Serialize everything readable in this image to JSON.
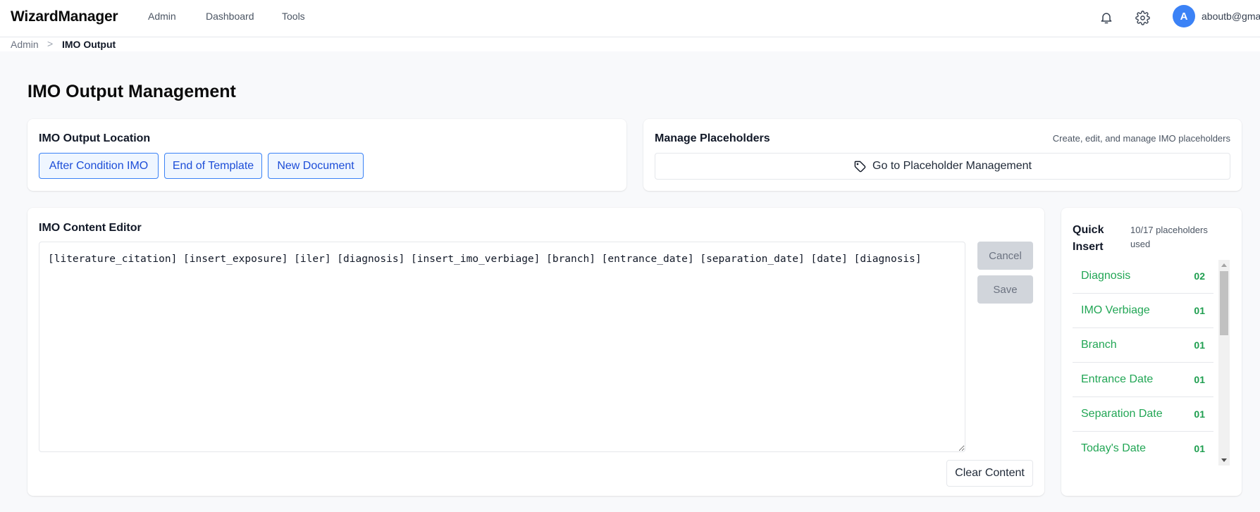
{
  "app": {
    "title": "WizardManager",
    "nav": [
      {
        "label": "Admin"
      },
      {
        "label": "Dashboard"
      },
      {
        "label": "Tools"
      }
    ],
    "user": {
      "avatar_initial": "A",
      "email": "aboutb@gma",
      "avatar_color": "#3b82f6"
    },
    "icons": {
      "notifications": "bell-icon",
      "settings": "gear-icon"
    }
  },
  "breadcrumb": {
    "root": "Admin",
    "separator": ">",
    "current": "IMO Output"
  },
  "page": {
    "title": "IMO Output Management"
  },
  "output_location": {
    "title": "IMO Output Location",
    "options": [
      {
        "label": "After Condition IMO"
      },
      {
        "label": "End of Template"
      },
      {
        "label": "New Document"
      }
    ],
    "accent_color": "#3b82f6"
  },
  "placeholders": {
    "title": "Manage Placeholders",
    "subtitle": "Create, edit, and manage IMO placeholders",
    "button_label": "Go to Placeholder Management",
    "button_icon": "tag-icon"
  },
  "editor": {
    "title": "IMO Content Editor",
    "content": "[literature_citation] [insert_exposure] [iler] [diagnosis] [insert_imo_verbiage] [branch] [entrance_date] [separation_date] [date] [diagnosis]",
    "cancel_label": "Cancel",
    "save_label": "Save",
    "clear_label": "Clear Content"
  },
  "quick_insert": {
    "title": "Quick Insert",
    "usage": "10/17 placeholders used",
    "items": [
      {
        "label": "Diagnosis",
        "count": "02"
      },
      {
        "label": "IMO Verbiage",
        "count": "01"
      },
      {
        "label": "Branch",
        "count": "01"
      },
      {
        "label": "Entrance Date",
        "count": "01"
      },
      {
        "label": "Separation Date",
        "count": "01"
      },
      {
        "label": "Today's Date",
        "count": "01"
      }
    ],
    "item_color": "#22a655"
  }
}
